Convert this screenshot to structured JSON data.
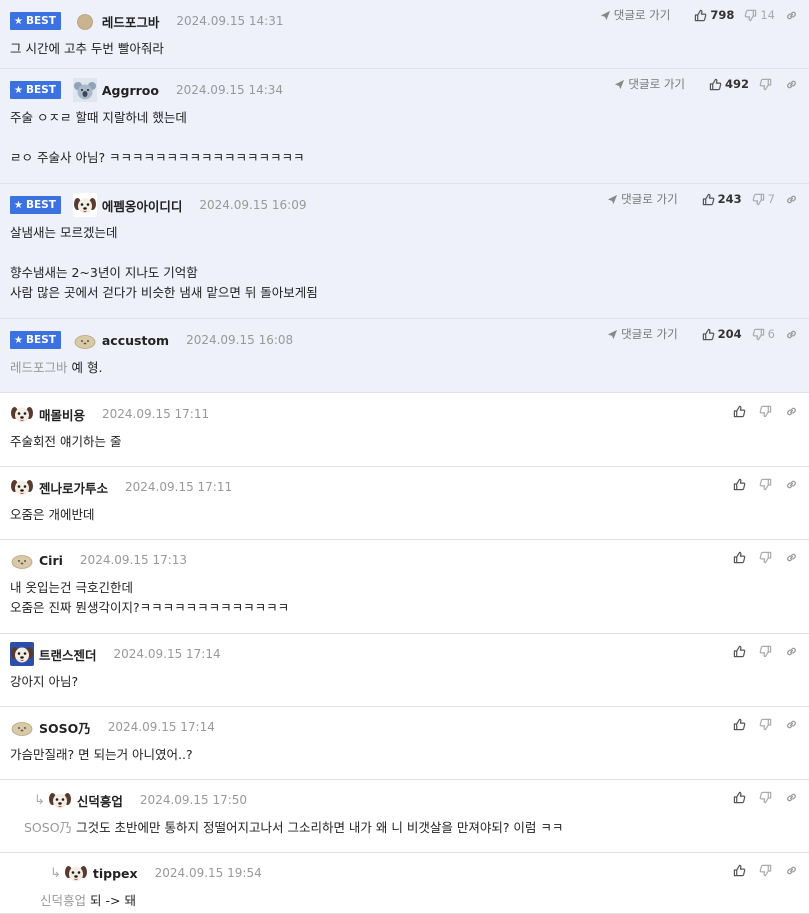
{
  "best_label": "BEST",
  "reply_label": "댓글로 가기",
  "comments": [
    {
      "best": true,
      "nick": "레드포그바",
      "date": "2024.09.15 14:31",
      "avatar": "round-tan",
      "up": "798",
      "down": "14",
      "lines": [
        "그 시간에 고추 두번 빨아줘라"
      ]
    },
    {
      "best": true,
      "nick": "Aggrroo",
      "date": "2024.09.15 14:34",
      "avatar": "koala",
      "up": "492",
      "down": "",
      "lines": [
        "주술 ㅇㅈㄹ 할때 지랄하네 했는데",
        "",
        "ㄹㅇ 주술사 아님? ㅋㅋㅋㅋㅋㅋㅋㅋㅋㅋㅋㅋㅋㅋㅋㅋㅋ"
      ]
    },
    {
      "best": true,
      "nick": "에펨옹아이디디",
      "date": "2024.09.15 16:09",
      "avatar": "dog",
      "up": "243",
      "down": "7",
      "lines": [
        "살냄새는 모르겠는데",
        "",
        "향수냄새는 2~3년이 지나도 기억함",
        "사람 많은 곳에서 걷다가 비슷한 냄새 맡으면 뒤 돌아보게됨"
      ]
    },
    {
      "best": true,
      "nick": "accustom",
      "date": "2024.09.15 16:08",
      "avatar": "blob",
      "up": "204",
      "down": "6",
      "mention": "레드포그바",
      "lines": [
        "예 형."
      ]
    },
    {
      "best": false,
      "nick": "매몰비용",
      "date": "2024.09.15 17:11",
      "avatar": "dog",
      "lines": [
        "주술회전 얘기하는 줄"
      ]
    },
    {
      "best": false,
      "nick": "젠나로가투소",
      "date": "2024.09.15 17:11",
      "avatar": "dog",
      "lines": [
        "오줌은 개에반데"
      ]
    },
    {
      "best": false,
      "nick": "Ciri",
      "date": "2024.09.15 17:13",
      "avatar": "blob",
      "lines": [
        "내 옷입는건 극호긴한데",
        "오줌은 진짜 뭔생각이지?ㅋㅋㅋㅋㅋㅋㅋㅋㅋㅋㅋㅋㅋ"
      ]
    },
    {
      "best": false,
      "nick": "트랜스젠더",
      "date": "2024.09.15 17:14",
      "avatar": "dog-blue",
      "lines": [
        "강아지 아님?"
      ]
    },
    {
      "best": false,
      "nick": "SOSO乃",
      "date": "2024.09.15 17:14",
      "avatar": "blob",
      "lines": [
        "가슴만질래? 면 되는거 아니였어..?"
      ]
    },
    {
      "best": false,
      "nick": "신덕흥업",
      "date": "2024.09.15 17:50",
      "avatar": "dog",
      "reply": 1,
      "mention": "SOSO乃",
      "lines": [
        "그것도 초반에만 통하지 정떨어지고나서 그소리하면 내가 왜 니 비갯살을 만져야되? 이럼 ㅋㅋ"
      ]
    },
    {
      "best": false,
      "nick": "tippex",
      "date": "2024.09.15 19:54",
      "avatar": "dog",
      "reply": 2,
      "mention": "신덕흥업",
      "lines": [
        "되 -> 돼"
      ]
    }
  ]
}
